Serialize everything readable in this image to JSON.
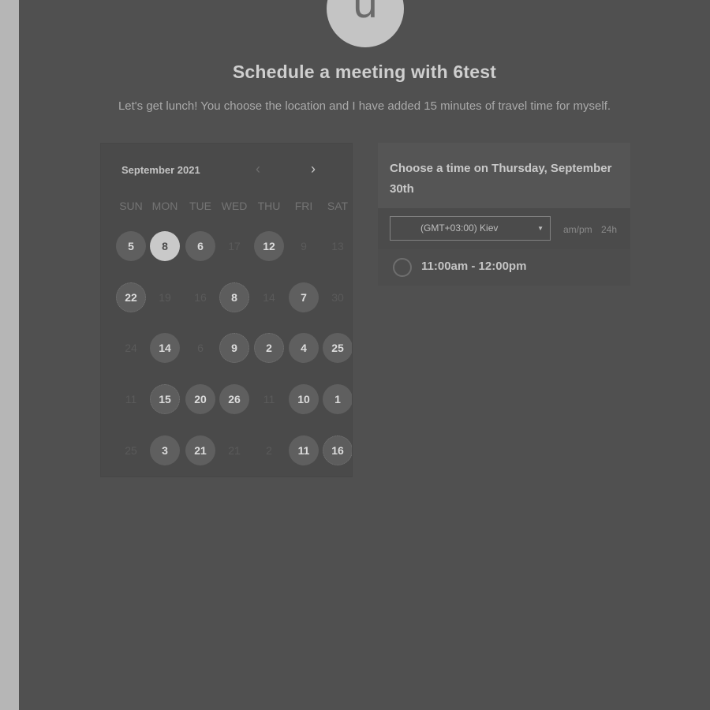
{
  "avatar": {
    "initial": "u"
  },
  "page": {
    "title": "Schedule a meeting with 6test",
    "subtitle": "Let's get lunch! You choose the location and I have added 15 minutes of travel time for myself."
  },
  "calendar": {
    "month_label": "September 2021",
    "prev_icon": "chevron-left-icon",
    "next_icon": "chevron-right-icon",
    "weekdays": [
      "SUN",
      "MON",
      "TUE",
      "WED",
      "THU",
      "FRI",
      "SAT"
    ],
    "weeks": [
      [
        {
          "label": "5",
          "state": "available"
        },
        {
          "label": "8",
          "state": "selected"
        },
        {
          "label": "6",
          "state": "available"
        },
        {
          "label": "17",
          "state": "unavailable"
        },
        {
          "label": "12",
          "state": "available"
        },
        {
          "label": "9",
          "state": "unavailable"
        },
        {
          "label": "13",
          "state": "unavailable"
        }
      ],
      [
        {
          "label": "22",
          "state": "dotted"
        },
        {
          "label": "19",
          "state": "unavailable"
        },
        {
          "label": "16",
          "state": "unavailable"
        },
        {
          "label": "8",
          "state": "dotted"
        },
        {
          "label": "14",
          "state": "unavailable"
        },
        {
          "label": "7",
          "state": "available"
        },
        {
          "label": "30",
          "state": "unavailable"
        }
      ],
      [
        {
          "label": "24",
          "state": "unavailable"
        },
        {
          "label": "14",
          "state": "available"
        },
        {
          "label": "6",
          "state": "unavailable"
        },
        {
          "label": "9",
          "state": "dotted"
        },
        {
          "label": "2",
          "state": "dotted"
        },
        {
          "label": "4",
          "state": "available"
        },
        {
          "label": "25",
          "state": "available"
        }
      ],
      [
        {
          "label": "11",
          "state": "unavailable"
        },
        {
          "label": "15",
          "state": "dotted"
        },
        {
          "label": "20",
          "state": "available"
        },
        {
          "label": "26",
          "state": "available"
        },
        {
          "label": "11",
          "state": "unavailable"
        },
        {
          "label": "10",
          "state": "available"
        },
        {
          "label": "1",
          "state": "available"
        }
      ],
      [
        {
          "label": "25",
          "state": "unavailable"
        },
        {
          "label": "3",
          "state": "available"
        },
        {
          "label": "21",
          "state": "available"
        },
        {
          "label": "21",
          "state": "unavailable"
        },
        {
          "label": "2",
          "state": "unavailable"
        },
        {
          "label": "11",
          "state": "available"
        },
        {
          "label": "16",
          "state": "dotted"
        }
      ]
    ]
  },
  "time_panel": {
    "title": "Choose a time on Thursday, September 30th",
    "timezone": "(GMT+03:00) Kiev",
    "caret_icon": "caret-down-icon",
    "format_ampm": "am/pm",
    "format_24h": "24h",
    "slots": [
      {
        "label": "11:00am - 12:00pm"
      }
    ]
  },
  "colors": {
    "background": "#505050",
    "selected_day": "#c9c9c9",
    "available_day": "#5f5f5f"
  }
}
